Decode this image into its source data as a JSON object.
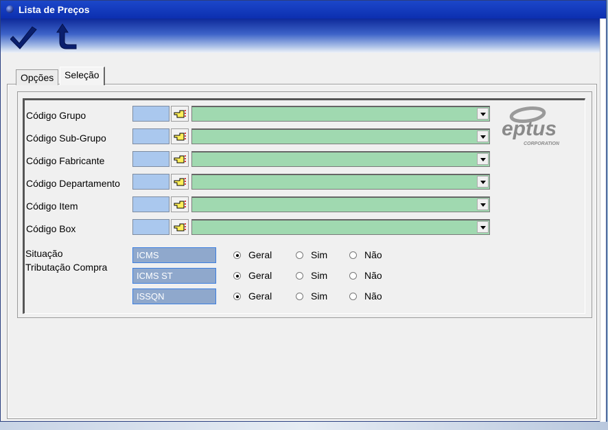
{
  "window": {
    "title": "Lista de Preços"
  },
  "toolbar": {
    "confirm_icon": "checkmark-icon",
    "back_icon": "return-arrow-icon"
  },
  "tabs": [
    {
      "label": "Opções",
      "active": false
    },
    {
      "label": "Seleção",
      "active": true
    }
  ],
  "fields": [
    {
      "label": "Código Grupo",
      "code": "",
      "description": ""
    },
    {
      "label": "Código Sub-Grupo",
      "code": "",
      "description": ""
    },
    {
      "label": "Código Fabricante",
      "code": "",
      "description": ""
    },
    {
      "label": "Código Departamento",
      "code": "",
      "description": ""
    },
    {
      "label": "Código Item",
      "code": "",
      "description": ""
    },
    {
      "label": "Código Box",
      "code": "",
      "description": ""
    }
  ],
  "logo": {
    "text": "eptus",
    "subtext": "CORPORATION"
  },
  "situacao": {
    "label_line1": "Situação",
    "label_line2": "Tributação Compra",
    "taxes": [
      {
        "name": "ICMS",
        "selected": "Geral"
      },
      {
        "name": "ICMS ST",
        "selected": "Geral"
      },
      {
        "name": "ISSQN",
        "selected": "Geral"
      }
    ],
    "options": [
      "Geral",
      "Sim",
      "Não"
    ]
  },
  "colors": {
    "titlebar": "#0c2fb0",
    "code_box": "#aac8ee",
    "combo": "#a0d9b0",
    "tax_box": "#8fa8cc"
  }
}
